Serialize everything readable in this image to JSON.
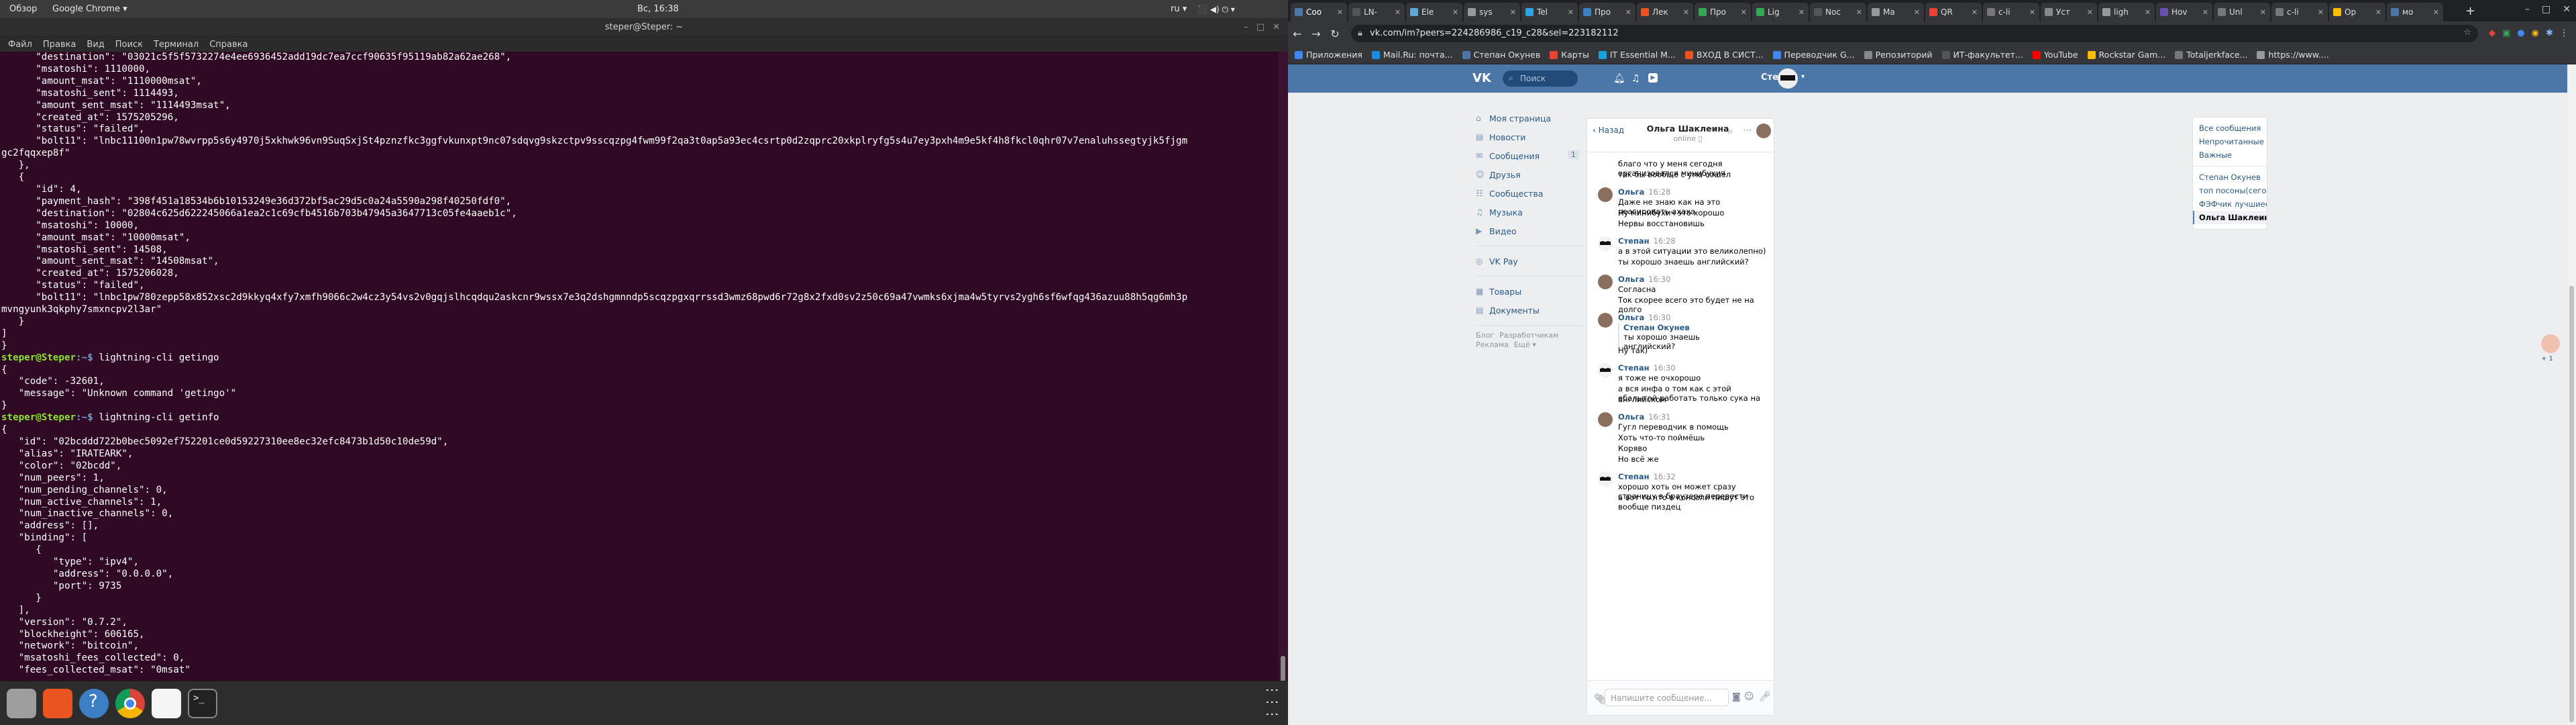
{
  "top_panel": {
    "overview": "Обзор",
    "app_name": "Google Chrome ▾",
    "clock": "Вс, 16:38",
    "lang": "ru ▾",
    "sys_icons": "⬛ ◀) ⏻ ▾"
  },
  "terminal": {
    "title": "steper@Steper: ~",
    "menu": [
      "Файл",
      "Правка",
      "Вид",
      "Поиск",
      "Терминал",
      "Справка"
    ],
    "lines": [
      "      \"destination\": \"03021c5f5f5732274e4ee6936452add19dc7ea7ccf90635f95119ab82a62ae268\",",
      "      \"msatoshi\": 1110000,",
      "      \"amount_msat\": \"1110000msat\",",
      "      \"msatoshi_sent\": 1114493,",
      "      \"amount_sent_msat\": \"1114493msat\",",
      "      \"created_at\": 1575205296,",
      "      \"status\": \"failed\",",
      "      \"bolt11\": \"lnbc11100n1pw78wvrpp5s6y4970j5xkhwk96vn9SuqSxjSt4pznzfkc3ggfvkunxpt9nc07sdqvg9skzctpv9sscqzpg4fwm99f2qa3t0ap5a93ec4csrtp0d2zqprc20xkplryfg5s4u7ey3pxh4m9e5kf4h8fkcl0qhr07v7enaluhssegtyjk5fjgm",
      "gc2fqqxep8f\"",
      "   },",
      "   {",
      "      \"id\": 4,",
      "      \"payment_hash\": \"398f451a18534b6b10153249e36d372bf5ac29d5c0a24a5590a298f40250fdf0\",",
      "      \"destination\": \"02804c625d622245066a1ea2c1c69cfb4516b703b47945a3647713c05fe4aaeb1c\",",
      "      \"msatoshi\": 10000,",
      "      \"amount_msat\": \"10000msat\",",
      "      \"msatoshi_sent\": 14508,",
      "      \"amount_sent_msat\": \"14508msat\",",
      "      \"created_at\": 1575206028,",
      "      \"status\": \"failed\",",
      "      \"bolt11\": \"lnbc1pw780zepp58x852xsc2d9kkyq4xfy7xmfh9066c2w4cz3y54vs2v0gqjslhcqdqu2askcnr9wssx7e3q2dshgmnndp5scqzpgxqrrssd3wmz68pwd6r72g8x2fxd0sv2z50c69a47vwmks6xjma4w5tyrvs2ygh6sf6wfqg436azuu88h5qg6mh3p",
      "mvngyunk3qkphy7smxncpv2l3ar\"",
      "   }",
      "]",
      "}"
    ],
    "block2": [
      {
        "type": "prompt",
        "cmd": "lightning-cli getingo"
      },
      {
        "type": "out",
        "text": "{"
      },
      {
        "type": "out",
        "text": "   \"code\": -32601,"
      },
      {
        "type": "out",
        "text": "   \"message\": \"Unknown command 'getingo'\""
      },
      {
        "type": "out",
        "text": "}"
      },
      {
        "type": "prompt",
        "cmd": "lightning-cli getinfo"
      },
      {
        "type": "out",
        "text": "{"
      },
      {
        "type": "out",
        "text": "   \"id\": \"02bcddd722b0bec5092ef752201ce0d59227310ee8ec32efc8473b1d50c10de59d\","
      },
      {
        "type": "out",
        "text": "   \"alias\": \"IRATEARK\","
      },
      {
        "type": "out",
        "text": "   \"color\": \"02bcdd\","
      },
      {
        "type": "out",
        "text": "   \"num_peers\": 1,"
      },
      {
        "type": "out",
        "text": "   \"num_pending_channels\": 0,"
      },
      {
        "type": "out",
        "text": "   \"num_active_channels\": 1,"
      },
      {
        "type": "out",
        "text": "   \"num_inactive_channels\": 0,"
      },
      {
        "type": "out",
        "text": "   \"address\": [],"
      },
      {
        "type": "out",
        "text": "   \"binding\": ["
      },
      {
        "type": "out",
        "text": "      {"
      },
      {
        "type": "out",
        "text": "         \"type\": \"ipv4\","
      },
      {
        "type": "out",
        "text": "         \"address\": \"0.0.0.0\","
      },
      {
        "type": "out",
        "text": "         \"port\": 9735"
      },
      {
        "type": "out",
        "text": "      }"
      },
      {
        "type": "out",
        "text": "   ],"
      },
      {
        "type": "out",
        "text": "   \"version\": \"0.7.2\","
      },
      {
        "type": "out",
        "text": "   \"blockheight\": 606165,"
      },
      {
        "type": "out",
        "text": "   \"network\": \"bitcoin\","
      },
      {
        "type": "out",
        "text": "   \"msatoshi_fees_collected\": 0,"
      },
      {
        "type": "out",
        "text": "   \"fees_collected_msat\": \"0msat\""
      }
    ],
    "prompt_user": "steper@Steper",
    "prompt_path": ":~$ "
  },
  "dock": {
    "apps": [
      {
        "name": "files",
        "color": "#9e9e9e"
      },
      {
        "name": "software-center",
        "color": "#e95420"
      },
      {
        "name": "help",
        "color": "#3d7fc4"
      },
      {
        "name": "chrome",
        "color": "#dd4b39"
      },
      {
        "name": "text-editor",
        "color": "#f5f5f5"
      },
      {
        "name": "terminal",
        "color": "#222222"
      }
    ],
    "grid_icon": "⋮⋮⋮"
  },
  "chrome": {
    "tabs": [
      {
        "label": "Соо",
        "color": "#4a76a8"
      },
      {
        "label": "LN-",
        "color": "#555"
      },
      {
        "label": "Ele",
        "color": "#5fa8d3"
      },
      {
        "label": "sys",
        "color": "#999"
      },
      {
        "label": "Tel",
        "color": "#2ca5e0"
      },
      {
        "label": "Про",
        "color": "#3d7fc4"
      },
      {
        "label": "Лек",
        "color": "#e95420"
      },
      {
        "label": "Про",
        "color": "#34a853"
      },
      {
        "label": "Lig",
        "color": "#34a853"
      },
      {
        "label": "Noc",
        "color": "#555"
      },
      {
        "label": "Ma",
        "color": "#999"
      },
      {
        "label": "QR",
        "color": "#ea4335"
      },
      {
        "label": "c-li",
        "color": "#777"
      },
      {
        "label": "Уст",
        "color": "#888"
      },
      {
        "label": "ligh",
        "color": "#999"
      },
      {
        "label": "Hov",
        "color": "#6a4fb3"
      },
      {
        "label": "Unl",
        "color": "#777"
      },
      {
        "label": "c-li",
        "color": "#777"
      },
      {
        "label": "Ор",
        "color": "#fbbc05"
      },
      {
        "label": "мо",
        "color": "#4a76a8"
      }
    ],
    "new_tab": "+",
    "window_controls": [
      "–",
      "□",
      "✕"
    ],
    "url": "vk.com/im?peers=224286986_c19_c28&sel=223182112",
    "extensions": [
      {
        "glyph": "◆",
        "color": "#ea4335"
      },
      {
        "glyph": "▣",
        "color": "#34a853"
      },
      {
        "glyph": "●",
        "color": "#4285f4"
      },
      {
        "glyph": "◉",
        "color": "#fbbc05"
      },
      {
        "glyph": "✱",
        "color": "#8ab4f8"
      },
      {
        "glyph": "⋮",
        "color": "#dddddd"
      }
    ],
    "bookmarks": [
      {
        "label": "Приложения",
        "color": "#4285f4"
      },
      {
        "label": "Mail.Ru: почта...",
        "color": "#168de2"
      },
      {
        "label": "Степан Окунев",
        "color": "#4a76a8"
      },
      {
        "label": "Карты",
        "color": "#ea4335"
      },
      {
        "label": "IT Essential M...",
        "color": "#1ba0d7"
      },
      {
        "label": "ВХОД В СИСТ...",
        "color": "#e95420"
      },
      {
        "label": "Переводчик G...",
        "color": "#4285f4"
      },
      {
        "label": "Репозиторий",
        "color": "#888"
      },
      {
        "label": "ИТ-факультет...",
        "color": "#555"
      },
      {
        "label": "YouTube",
        "color": "#ff0000"
      },
      {
        "label": "Rockstar Gam...",
        "color": "#fbbc05"
      },
      {
        "label": "Totaljerkface...",
        "color": "#777"
      },
      {
        "label": "https://www....",
        "color": "#999"
      }
    ]
  },
  "vk": {
    "search_placeholder": "Поиск",
    "user_name": "Степан",
    "nav": [
      {
        "label": "Моя страница",
        "icon": "⌂"
      },
      {
        "label": "Новости",
        "icon": "▤"
      },
      {
        "label": "Сообщения",
        "icon": "✉",
        "count": "1"
      },
      {
        "label": "Друзья",
        "icon": "☺"
      },
      {
        "label": "Сообщества",
        "icon": "☷"
      },
      {
        "label": "Музыка",
        "icon": "♫"
      },
      {
        "label": "Видео",
        "icon": "▶"
      },
      {
        "label": "VK Pay",
        "icon": "◎"
      },
      {
        "label": "Товары",
        "icon": "▦"
      },
      {
        "label": "Документы",
        "icon": "▤"
      }
    ],
    "footer_links": [
      "Блог",
      "Разработчикам",
      "Реклама",
      "Ещё ▾"
    ],
    "chat": {
      "back": "Назад",
      "name": "Ольга Шаклеина",
      "status": "online ▯",
      "input_placeholder": "Напишите сообщение..."
    },
    "messages": [
      {
        "type": "line",
        "text": "благо что у меня сегодня организовался минибухич"
      },
      {
        "type": "line",
        "text": "так бы вообще с ума сошёл"
      },
      {
        "type": "head",
        "who": "Ольга",
        "time": "16:28",
        "avatar": "olga"
      },
      {
        "type": "line",
        "text": "Даже не знаю как на это реагировать ахаха"
      },
      {
        "type": "line",
        "text": "Ну минибухич это хорошо"
      },
      {
        "type": "line",
        "text": "Нервы восстановишь"
      },
      {
        "type": "head",
        "who": "Степан",
        "time": "16:28",
        "avatar": "stepan"
      },
      {
        "type": "line",
        "text": "а в этой ситуации это великолепно)"
      },
      {
        "type": "line",
        "text": "ты хорошо знаешь английский?"
      },
      {
        "type": "head",
        "who": "Ольга",
        "time": "16:30",
        "avatar": "olga"
      },
      {
        "type": "line",
        "text": "Согласна"
      },
      {
        "type": "line",
        "text": "Ток скорее всего это будет не на долго"
      },
      {
        "type": "head",
        "who": "Ольга",
        "time": "16:30",
        "avatar": "olga"
      },
      {
        "type": "fwd",
        "name": "Степан Окунев",
        "text": "ты хорошо знаешь английский?"
      },
      {
        "type": "line",
        "text": "Ну так)"
      },
      {
        "type": "head",
        "who": "Степан",
        "time": "16:30",
        "avatar": "stepan"
      },
      {
        "type": "line",
        "text": "я тоже не очхорошо"
      },
      {
        "type": "line",
        "text": "а вся инфа о том как с этой ебалыгой работать только сука на"
      },
      {
        "type": "line",
        "text": "английском"
      },
      {
        "type": "head",
        "who": "Ольга",
        "time": "16:31",
        "avatar": "olga"
      },
      {
        "type": "line",
        "text": "Гугл переводчик в помощь"
      },
      {
        "type": "line",
        "text": "Хоть что-то поймёшь"
      },
      {
        "type": "line",
        "text": "Коряво"
      },
      {
        "type": "line",
        "text": "Но всё же"
      },
      {
        "type": "head",
        "who": "Степан",
        "time": "16:32",
        "avatar": "stepan"
      },
      {
        "type": "line",
        "text": "хорошо хоть он может сразу страницу в браузере перевести"
      },
      {
        "type": "line",
        "text": "а вот то что в консоли пишут это вообще пиздец"
      }
    ],
    "filters": [
      {
        "label": "Все сообщения"
      },
      {
        "label": "Непрочитанные"
      },
      {
        "label": "Важные"
      },
      {
        "label": "sep"
      },
      {
        "label": "Степан Окунев"
      },
      {
        "label": "топ посоны(сегодня вечер..."
      },
      {
        "label": "ФЭФчик лучшиее уууу ...",
        "count": "+1"
      },
      {
        "label": "Ольга Шаклеина",
        "active": true
      }
    ],
    "right_count": "+ 1"
  }
}
